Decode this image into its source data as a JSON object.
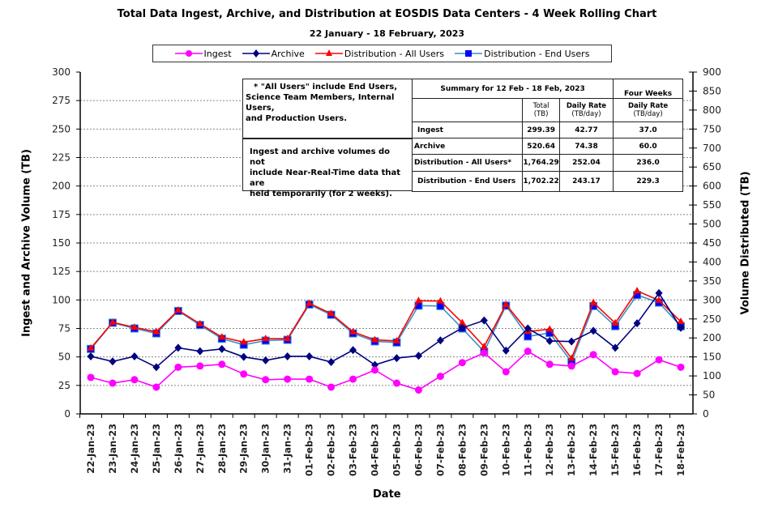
{
  "chart_data": {
    "type": "line",
    "title": "Total Data Ingest, Archive, and  Distribution at EOSDIS Data Centers - 4 Week Rolling Chart",
    "subtitle": "22  January  -  18  February,  2023",
    "xlabel": "Date",
    "ylabel": "Ingest and Archive Volume (TB)",
    "ylabel_right": "Volume Distributed (TB)",
    "ylim": [
      0,
      300
    ],
    "ylim_right": [
      0,
      900
    ],
    "yticks": [
      0,
      25,
      50,
      75,
      100,
      125,
      150,
      175,
      200,
      225,
      250,
      275,
      300
    ],
    "yticks_right": [
      0,
      50,
      100,
      150,
      200,
      250,
      300,
      350,
      400,
      450,
      500,
      550,
      600,
      650,
      700,
      750,
      800,
      850,
      900
    ],
    "grid": true,
    "legend_position": "top",
    "categories": [
      "22-Jan-23",
      "23-Jan-23",
      "24-Jan-23",
      "25-Jan-23",
      "26-Jan-23",
      "27-Jan-23",
      "28-Jan-23",
      "29-Jan-23",
      "30-Jan-23",
      "31-Jan-23",
      "01-Feb-23",
      "02-Feb-23",
      "03-Feb-23",
      "04-Feb-23",
      "05-Feb-23",
      "06-Feb-23",
      "07-Feb-23",
      "08-Feb-23",
      "09-Feb-23",
      "10-Feb-23",
      "11-Feb-23",
      "12-Feb-23",
      "13-Feb-23",
      "14-Feb-23",
      "15-Feb-23",
      "16-Feb-23",
      "17-Feb-23",
      "18-Feb-23"
    ],
    "series": [
      {
        "name": "Ingest",
        "axis": "left",
        "color": "#ff00ff",
        "marker": "circle",
        "values": [
          32,
          27,
          30,
          23.5,
          41,
          42,
          43.5,
          35,
          30,
          30.5,
          30.5,
          23.5,
          30.5,
          38.5,
          27,
          21,
          33,
          45,
          53.5,
          37,
          55,
          43.5,
          42,
          52,
          37,
          35.5,
          47.5,
          41
        ]
      },
      {
        "name": "Archive",
        "axis": "left",
        "color": "#000080",
        "marker": "diamond",
        "values": [
          50.5,
          46,
          50.5,
          41,
          58,
          55,
          57,
          50,
          47,
          50.5,
          50.5,
          45.5,
          56,
          43,
          49,
          51,
          64.5,
          75.5,
          82,
          55.5,
          75,
          64,
          63.5,
          73,
          58,
          79.5,
          106,
          75.5
        ]
      },
      {
        "name": "Distribution - All Users",
        "axis": "right",
        "color": "#ff0000",
        "marker": "triangle",
        "values": [
          173,
          241,
          228,
          216,
          273,
          237,
          202,
          189,
          198,
          198,
          291,
          264,
          216,
          195,
          192,
          298,
          297,
          240,
          177,
          288,
          217,
          223,
          146,
          293,
          239,
          324,
          299,
          243
        ]
      },
      {
        "name": "Distribution - End Users",
        "axis": "right",
        "color": "#0000ff",
        "line_color": "#3a8fc8",
        "marker": "square",
        "values": [
          171,
          240,
          225,
          212,
          271,
          234,
          198,
          182,
          193,
          195,
          288,
          261,
          212,
          191,
          188,
          285,
          284,
          225,
          164,
          285,
          204,
          213,
          137,
          284,
          231,
          313,
          293,
          231
        ]
      }
    ]
  },
  "notes": {
    "all_users": [
      "* \"All Users\" include End Users,",
      "Science Team Members,  Internal Users,",
      "and Production Users."
    ],
    "nrt": [
      "Ingest and archive volumes do not",
      "include Near-Real-Time data that are",
      "held temporarily (for 2 weeks)."
    ]
  },
  "summary": {
    "header": "Summary for  12  Feb  -  18  Feb,  2023",
    "four_weeks": "Four Weeks",
    "col_total": [
      "Total",
      "(TB)"
    ],
    "col_daily": [
      "Daily Rate",
      "(TB/day)"
    ],
    "col_four_daily": [
      "Daily Rate",
      "(TB/day)"
    ],
    "rows": [
      {
        "label": "Ingest",
        "total": "299.39",
        "daily": "42.77",
        "four": "37.0"
      },
      {
        "label": "Archive",
        "total": "520.64",
        "daily": "74.38",
        "four": "60.0"
      },
      {
        "label": "Distribution - All Users*",
        "total": "1,764.29",
        "daily": "252.04",
        "four": "236.0"
      },
      {
        "label": "Distribution - End Users",
        "total": "1,702.22",
        "daily": "243.17",
        "four": "229.3"
      }
    ]
  }
}
